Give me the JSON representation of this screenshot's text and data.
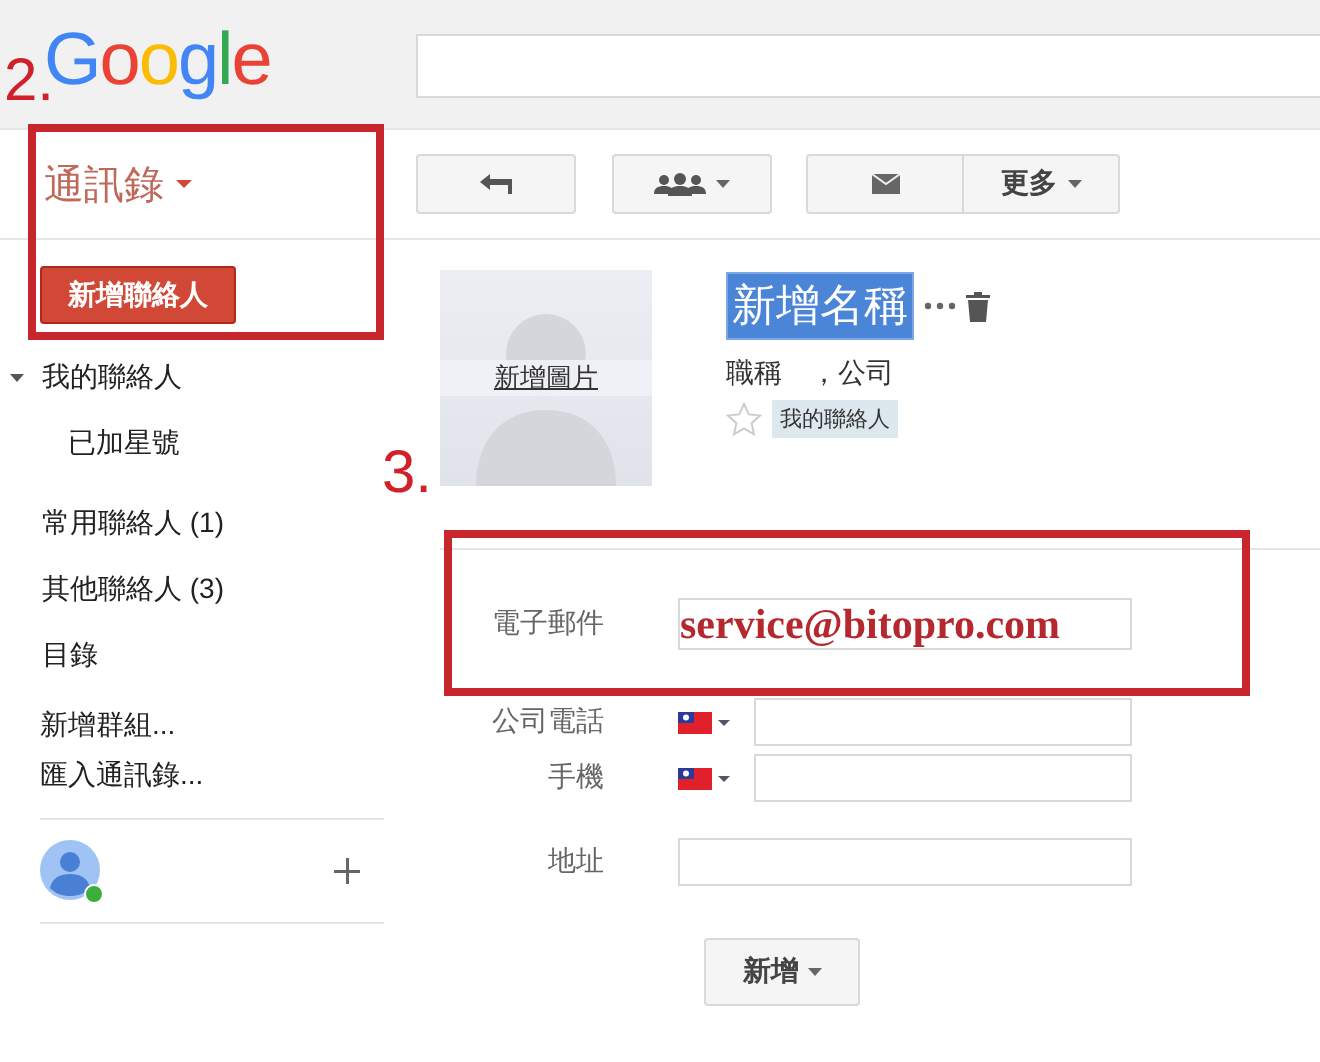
{
  "header": {
    "logo": "Google"
  },
  "app_title": "通訊錄",
  "new_contact_button": "新增聯絡人",
  "sidebar": {
    "groups": [
      {
        "label": "我的聯絡人",
        "expanded": true,
        "children": [
          {
            "label": "已加星號"
          }
        ]
      },
      {
        "label": "常用聯絡人 (1)"
      },
      {
        "label": "其他聯絡人 (3)"
      },
      {
        "label": "目錄"
      }
    ],
    "actions": [
      "新增群組...",
      "匯入通訊錄..."
    ]
  },
  "toolbar": {
    "more_button": "更多"
  },
  "contact": {
    "photo_link": "新增圖片",
    "name": "新增名稱",
    "name_selected": true,
    "job": "職稱",
    "company": "，公司",
    "starred": false,
    "group_tag": "我的聯絡人"
  },
  "fields": [
    {
      "kind": "email",
      "label": "電子郵件",
      "value": "service@bitopro.com"
    },
    {
      "kind": "phone",
      "label": "公司電話"
    },
    {
      "kind": "phone",
      "label": "手機"
    },
    {
      "kind": "text",
      "label": "地址"
    }
  ],
  "add_button": "新增",
  "annotations": [
    {
      "label": "2."
    },
    {
      "label": "3."
    }
  ]
}
